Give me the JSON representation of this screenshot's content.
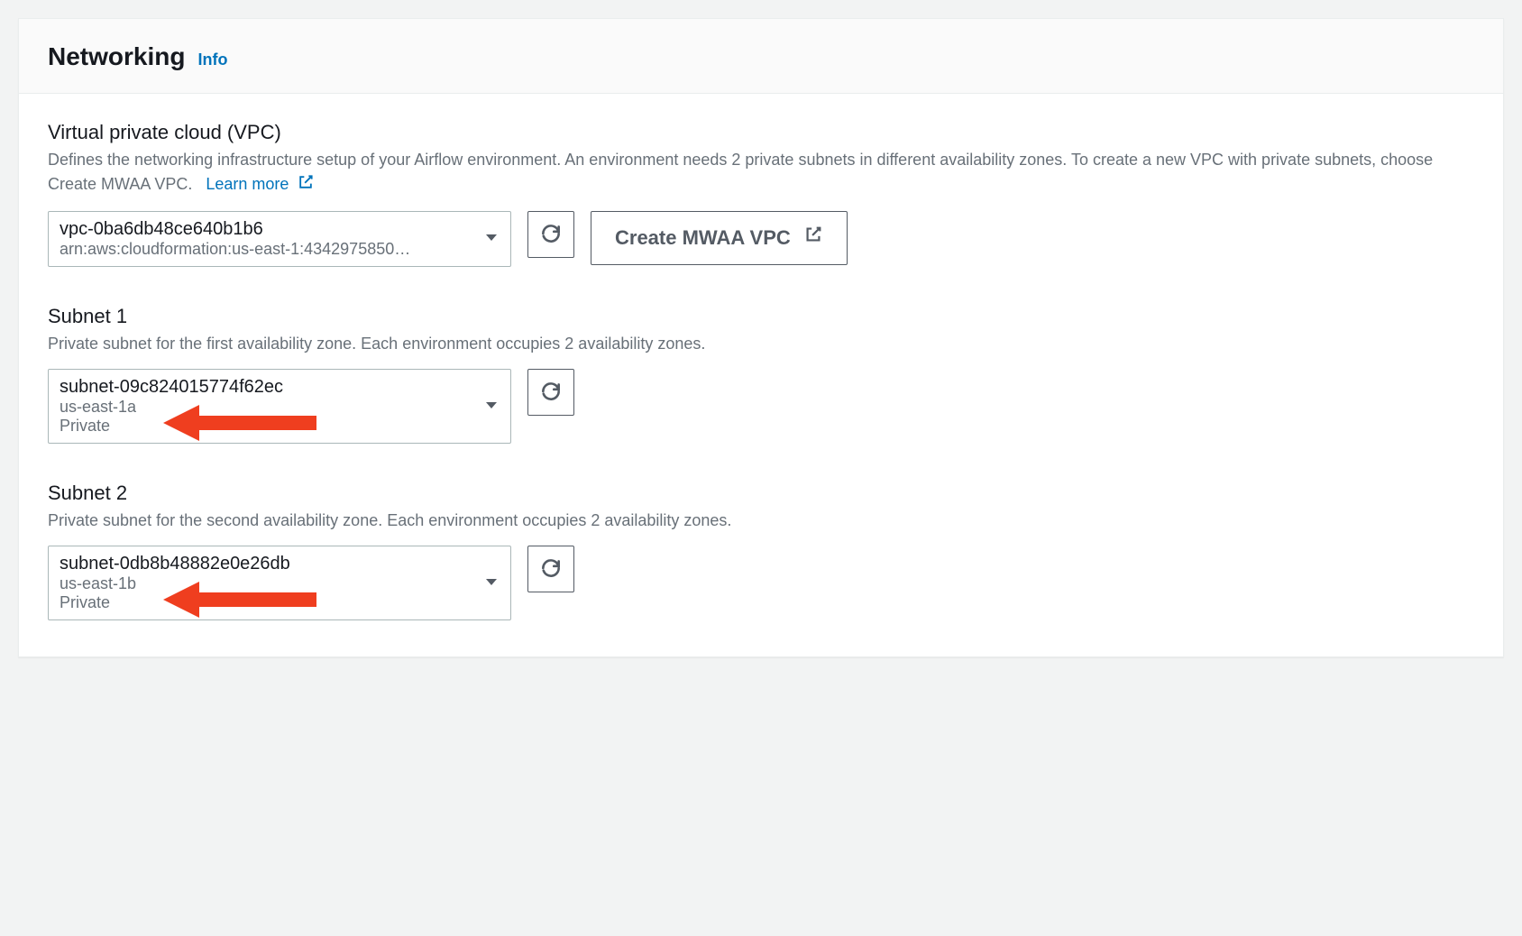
{
  "header": {
    "title": "Networking",
    "info_label": "Info"
  },
  "vpc": {
    "label": "Virtual private cloud (VPC)",
    "description_pre": "Defines the networking infrastructure setup of your Airflow environment. An environment needs 2 private subnets in different availability zones. To create a new VPC with private subnets, choose Create MWAA VPC.",
    "learn_more": "Learn more",
    "selected_id": "vpc-0ba6db48ce640b1b6",
    "selected_arn": "arn:aws:cloudformation:us-east-1:4342975850…",
    "create_button": "Create MWAA VPC"
  },
  "subnet1": {
    "label": "Subnet 1",
    "description": "Private subnet for the first availability zone. Each environment occupies 2 availability zones.",
    "selected_id": "subnet-09c824015774f62ec",
    "az": "us-east-1a",
    "type": "Private"
  },
  "subnet2": {
    "label": "Subnet 2",
    "description": "Private subnet for the second availability zone. Each environment occupies 2 availability zones.",
    "selected_id": "subnet-0db8b48882e0e26db",
    "az": "us-east-1b",
    "type": "Private"
  }
}
